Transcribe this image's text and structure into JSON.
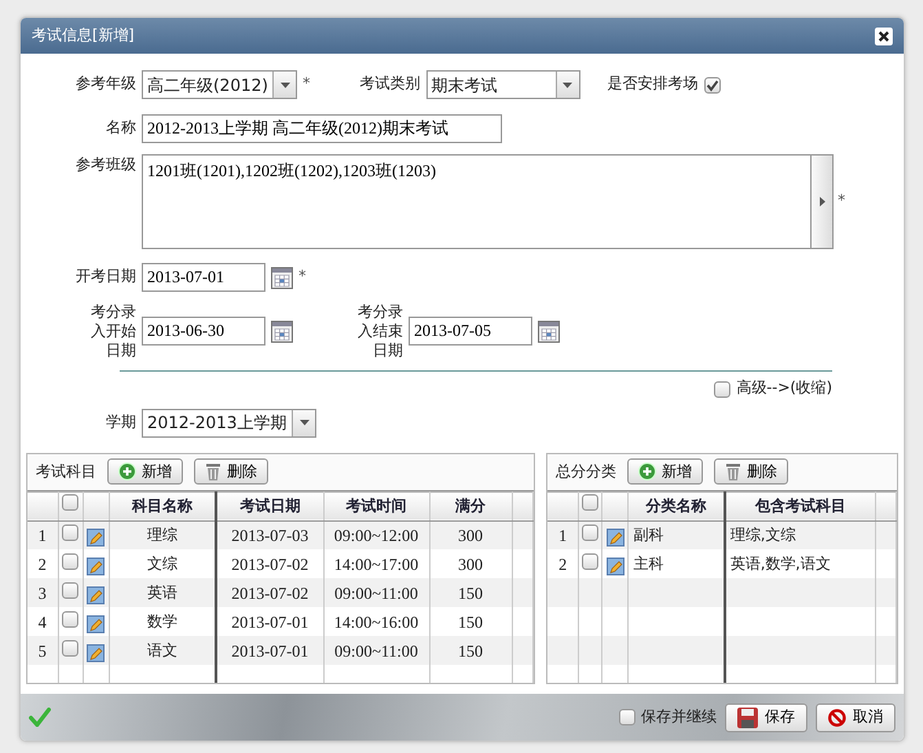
{
  "window": {
    "title": "考试信息[新增]"
  },
  "form": {
    "grade": {
      "label": "参考年级",
      "value": "高二年级(2012)",
      "required_mark": "*"
    },
    "exam_type": {
      "label": "考试类别",
      "value": "期末考试"
    },
    "arrange_room": {
      "label": "是否安排考场",
      "checked": true
    },
    "name": {
      "label": "名称",
      "value": "2012-2013上学期 高二年级(2012)期末考试"
    },
    "classes": {
      "label": "参考班级",
      "value": "1201班(1201),1202班(1202),1203班(1203)",
      "required_mark": "*"
    },
    "start_date": {
      "label": "开考日期",
      "value": "2013-07-01",
      "required_mark": "*"
    },
    "entry_start": {
      "label": "考分录入开始日期",
      "value": "2013-06-30"
    },
    "entry_end": {
      "label": "考分录入结束日期",
      "value": "2013-07-05"
    },
    "advanced": {
      "label": "高级-->(收缩)",
      "checked": false
    },
    "term": {
      "label": "学期",
      "value": "2012-2013上学期"
    }
  },
  "subjects": {
    "title": "考试科目",
    "buttons": [
      {
        "kind": "add",
        "label": "新增"
      },
      {
        "kind": "delete",
        "label": "删除"
      }
    ],
    "header_checked": false,
    "columns": [
      "科目名称",
      "考试日期",
      "考试时间",
      "满分"
    ],
    "rows": [
      {
        "index": "1",
        "checked": false,
        "cells": [
          "理综",
          "2013-07-03",
          "09:00~12:00",
          "300"
        ]
      },
      {
        "index": "2",
        "checked": false,
        "cells": [
          "文综",
          "2013-07-02",
          "14:00~17:00",
          "300"
        ]
      },
      {
        "index": "3",
        "checked": false,
        "cells": [
          "英语",
          "2013-07-02",
          "09:00~11:00",
          "150"
        ]
      },
      {
        "index": "4",
        "checked": false,
        "cells": [
          "数学",
          "2013-07-01",
          "14:00~16:00",
          "150"
        ]
      },
      {
        "index": "5",
        "checked": false,
        "cells": [
          "语文",
          "2013-07-01",
          "09:00~11:00",
          "150"
        ]
      }
    ]
  },
  "categories": {
    "title": "总分分类",
    "buttons": [
      {
        "kind": "add",
        "label": "新增"
      },
      {
        "kind": "delete",
        "label": "删除"
      }
    ],
    "header_checked": false,
    "columns": [
      "分类名称",
      "包含考试科目"
    ],
    "rows": [
      {
        "index": "1",
        "checked": false,
        "cells": [
          "副科",
          "理综,文综"
        ]
      },
      {
        "index": "2",
        "checked": false,
        "cells": [
          "主科",
          "英语,数学,语文"
        ]
      }
    ]
  },
  "footer": {
    "save_continue": {
      "label": "保存并继续",
      "checked": false
    },
    "buttons": [
      {
        "kind": "save",
        "label": "保存"
      },
      {
        "kind": "cancel",
        "label": "取消"
      }
    ]
  }
}
